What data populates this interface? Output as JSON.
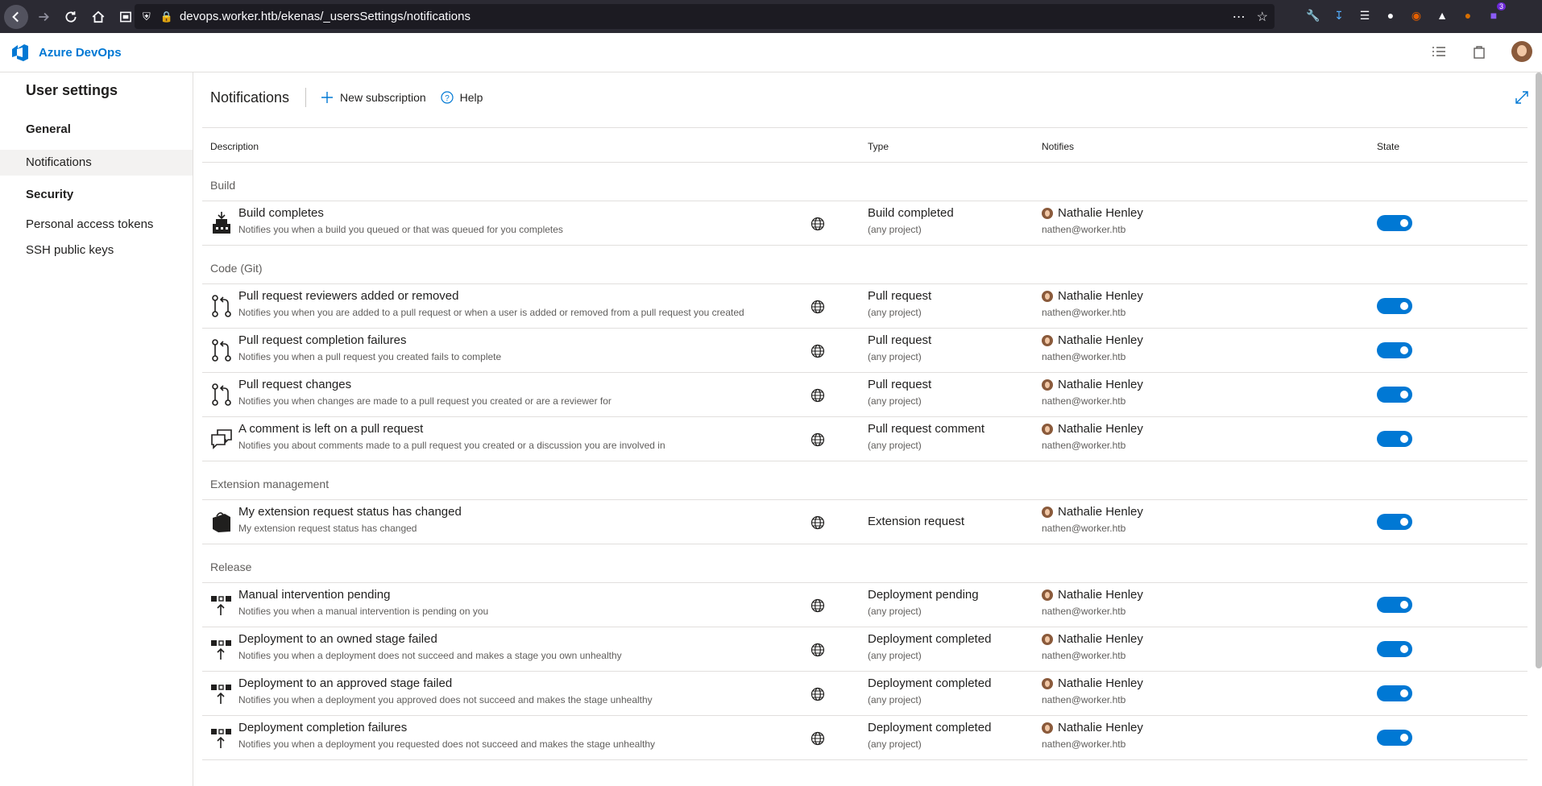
{
  "browser": {
    "url": "devops.worker.htb/ekenas/_usersSettings/notifications",
    "badge": "3"
  },
  "header": {
    "brand": "Azure DevOps"
  },
  "sidebar": {
    "title": "User settings",
    "sections": [
      {
        "label": "General",
        "items": [
          {
            "label": "Notifications",
            "active": true
          }
        ]
      },
      {
        "label": "Security",
        "items": [
          {
            "label": "Personal access tokens"
          },
          {
            "label": "SSH public keys"
          }
        ]
      }
    ]
  },
  "toolbar": {
    "title": "Notifications",
    "new_subscription": "New subscription",
    "help": "Help"
  },
  "table": {
    "columns": [
      "Description",
      "Type",
      "Notifies",
      "State"
    ],
    "groups": [
      {
        "name": "Build",
        "rows": [
          {
            "icon": "build-icon",
            "title": "Build completes",
            "desc": "Notifies you when a build you queued or that was queued for you completes",
            "type": "Build completed",
            "scope": "(any project)",
            "user": "Nathalie Henley",
            "email": "nathen@worker.htb",
            "enabled": true
          }
        ]
      },
      {
        "name": "Code (Git)",
        "rows": [
          {
            "icon": "pull-request-icon",
            "title": "Pull request reviewers added or removed",
            "desc": "Notifies you when you are added to a pull request or when a user is added or removed from a pull request you created",
            "type": "Pull request",
            "scope": "(any project)",
            "user": "Nathalie Henley",
            "email": "nathen@worker.htb",
            "enabled": true
          },
          {
            "icon": "pull-request-icon",
            "title": "Pull request completion failures",
            "desc": "Notifies you when a pull request you created fails to complete",
            "type": "Pull request",
            "scope": "(any project)",
            "user": "Nathalie Henley",
            "email": "nathen@worker.htb",
            "enabled": true
          },
          {
            "icon": "pull-request-icon",
            "title": "Pull request changes",
            "desc": "Notifies you when changes are made to a pull request you created or are a reviewer for",
            "type": "Pull request",
            "scope": "(any project)",
            "user": "Nathalie Henley",
            "email": "nathen@worker.htb",
            "enabled": true
          },
          {
            "icon": "comment-icon",
            "title": "A comment is left on a pull request",
            "desc": "Notifies you about comments made to a pull request you created or a discussion you are involved in",
            "type": "Pull request comment",
            "scope": "(any project)",
            "user": "Nathalie Henley",
            "email": "nathen@worker.htb",
            "enabled": true
          }
        ]
      },
      {
        "name": "Extension management",
        "rows": [
          {
            "icon": "extension-bag-icon",
            "title": "My extension request status has changed",
            "desc": "My extension request status has changed",
            "type": "Extension request",
            "scope": "",
            "user": "Nathalie Henley",
            "email": "nathen@worker.htb",
            "enabled": true
          }
        ]
      },
      {
        "name": "Release",
        "rows": [
          {
            "icon": "release-icon",
            "title": "Manual intervention pending",
            "desc": "Notifies you when a manual intervention is pending on you",
            "type": "Deployment pending",
            "scope": "(any project)",
            "user": "Nathalie Henley",
            "email": "nathen@worker.htb",
            "enabled": true
          },
          {
            "icon": "release-icon",
            "title": "Deployment to an owned stage failed",
            "desc": "Notifies you when a deployment does not succeed and makes a stage you own unhealthy",
            "type": "Deployment completed",
            "scope": "(any project)",
            "user": "Nathalie Henley",
            "email": "nathen@worker.htb",
            "enabled": true
          },
          {
            "icon": "release-icon",
            "title": "Deployment to an approved stage failed",
            "desc": "Notifies you when a deployment you approved does not succeed and makes the stage unhealthy",
            "type": "Deployment completed",
            "scope": "(any project)",
            "user": "Nathalie Henley",
            "email": "nathen@worker.htb",
            "enabled": true
          },
          {
            "icon": "release-icon",
            "title": "Deployment completion failures",
            "desc": "Notifies you when a deployment you requested does not succeed and makes the stage unhealthy",
            "type": "Deployment completed",
            "scope": "(any project)",
            "user": "Nathalie Henley",
            "email": "nathen@worker.htb",
            "enabled": true
          }
        ]
      }
    ]
  },
  "colors": {
    "accent": "#0078d4",
    "browser_bg": "#2b2a33"
  }
}
